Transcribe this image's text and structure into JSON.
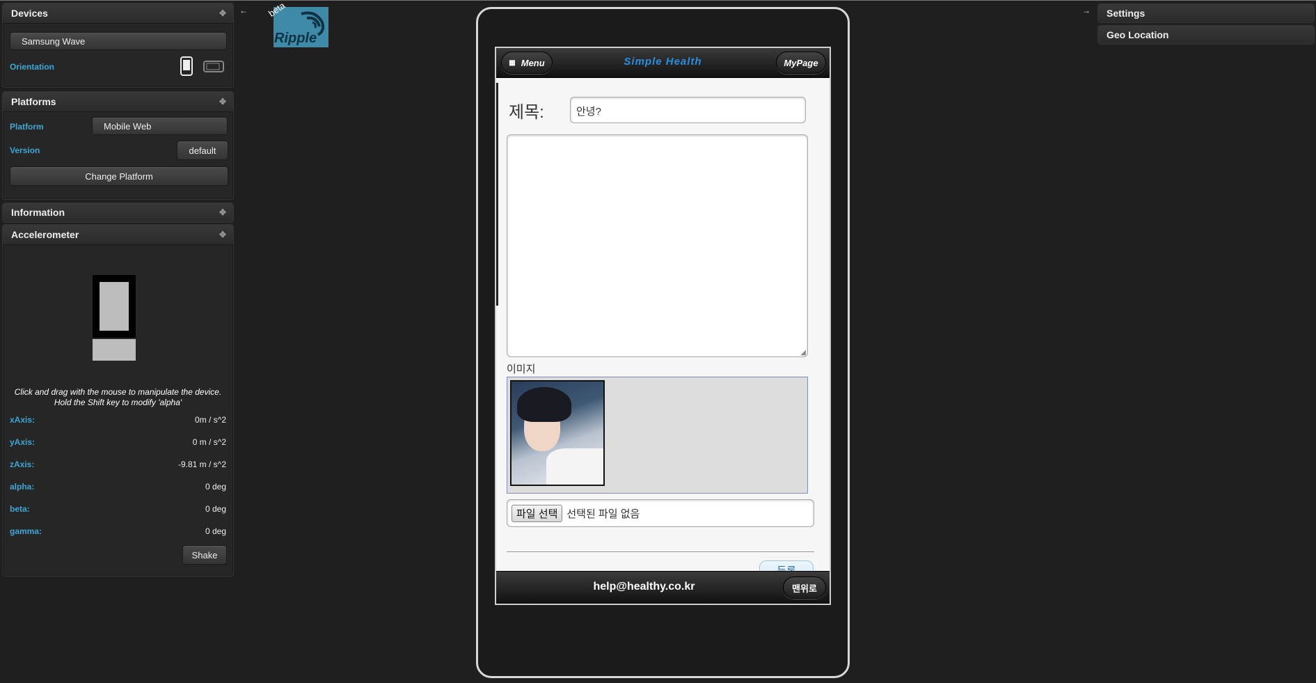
{
  "left_panels": {
    "devices": {
      "title": "Devices",
      "device": "Samsung Wave",
      "orientation_label": "Orientation"
    },
    "platforms": {
      "title": "Platforms",
      "platform_label": "Platform",
      "platform_value": "Mobile Web",
      "version_label": "Version",
      "version_value": "default",
      "change_button": "Change Platform"
    },
    "information": {
      "title": "Information"
    },
    "accelerometer": {
      "title": "Accelerometer",
      "instructions_1": "Click and drag with the mouse to manipulate the device.",
      "instructions_2": "Hold the Shift key to modify 'alpha'",
      "rows": [
        {
          "label": "xAxis:",
          "value": "0m / s^2"
        },
        {
          "label": "yAxis:",
          "value": "0 m / s^2"
        },
        {
          "label": "zAxis:",
          "value": "-9.81 m / s^2"
        },
        {
          "label": "alpha:",
          "value": "0 deg"
        },
        {
          "label": "beta:",
          "value": "0 deg"
        },
        {
          "label": "gamma:",
          "value": "0 deg"
        }
      ],
      "shake_button": "Shake"
    }
  },
  "right_panels": {
    "settings": "Settings",
    "geo_location": "Geo Location"
  },
  "logo": {
    "text": "Ripple",
    "badge": "beta"
  },
  "app": {
    "menu_button": "Menu",
    "title": "Simple Health",
    "mypage_button": "MyPage",
    "subject_label": "제목:",
    "subject_value": "안녕?",
    "body_value": "",
    "image_label": "이미지",
    "file_button": "파일 선택",
    "file_status": "선택된 파일 없음",
    "submit_button": "등록",
    "footer_email": "help@healthy.co.kr",
    "top_button": "맨위로"
  },
  "colors": {
    "accent": "#3aa8d8",
    "app_title": "#2a8fe0"
  }
}
